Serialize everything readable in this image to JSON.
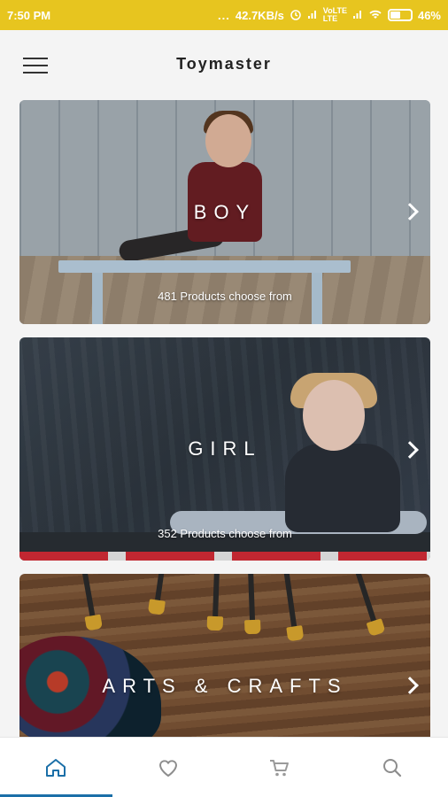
{
  "status_bar": {
    "time": "7:50 PM",
    "dots": "...",
    "network_speed": "42.7KB/s",
    "network_label_1": "VoLTE",
    "network_label_2": "LTE",
    "battery": "46%"
  },
  "header": {
    "title": "Toymaster",
    "menu_icon": "menu-icon"
  },
  "categories": [
    {
      "title": "BOY",
      "subtitle": "481 Products choose from"
    },
    {
      "title": "GIRL",
      "subtitle": "352 Products choose from"
    },
    {
      "title": "ARTS & CRAFTS",
      "subtitle": ""
    }
  ],
  "bottom_nav": [
    {
      "icon": "home-icon",
      "active": true,
      "color": "#1b6fa8"
    },
    {
      "icon": "heart-icon",
      "active": false,
      "color": "#8d8d8d"
    },
    {
      "icon": "cart-icon",
      "active": false,
      "color": "#8d8d8d"
    },
    {
      "icon": "search-icon",
      "active": false,
      "color": "#8d8d8d"
    }
  ],
  "colors": {
    "status_bar": "#e7c51f",
    "accent": "#1b6fa8"
  }
}
